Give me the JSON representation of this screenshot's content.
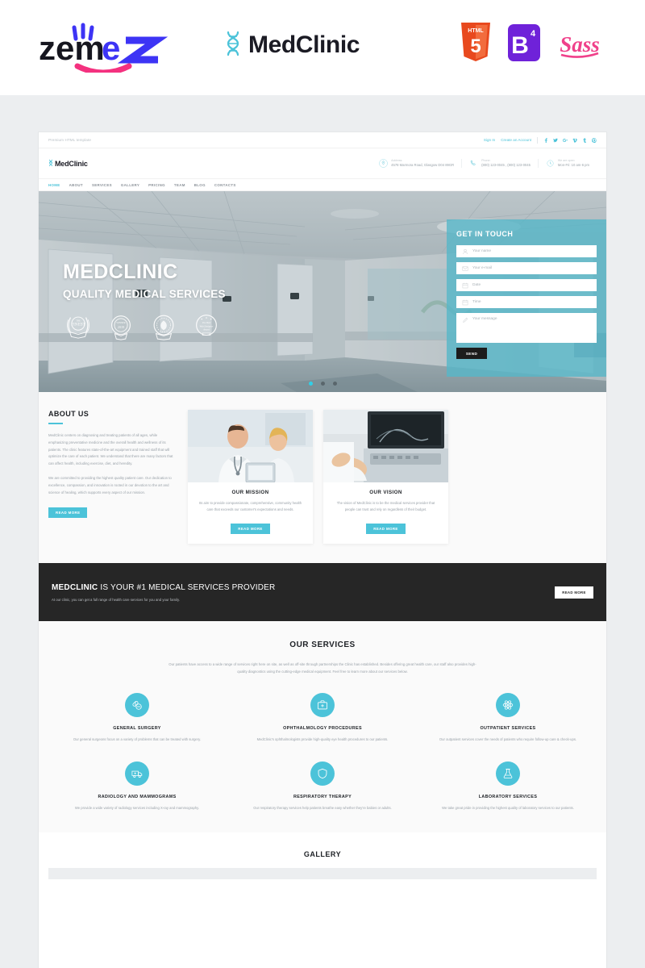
{
  "brandbar": {
    "zemez_logo_text": "zemez",
    "product_logo_text": "MedClinic",
    "badges": [
      {
        "name": "html5-badge",
        "label": "HTML",
        "sub": "5"
      },
      {
        "name": "bootstrap4-badge",
        "label": "B",
        "sub": "4"
      },
      {
        "name": "sass-badge",
        "label": "Sass"
      }
    ]
  },
  "site": {
    "topbar": {
      "tagline": "Premium HTML template",
      "sign_in": "Sign In",
      "create_account": "Create an Account",
      "social": [
        {
          "name": "facebook-icon"
        },
        {
          "name": "twitter-icon"
        },
        {
          "name": "google-plus-icon"
        },
        {
          "name": "vimeo-icon"
        },
        {
          "name": "tumblr-icon"
        },
        {
          "name": "pinterest-icon"
        }
      ]
    },
    "header": {
      "brand": "MedClinic",
      "contacts": [
        {
          "icon": "map-pin-icon",
          "label": "Address:",
          "value": "4578 Marmora Road, Glasgow D04 89GR"
        },
        {
          "icon": "phone-icon",
          "label": "Phone:",
          "value": "(800) 123-0045 , (800) 123-0045"
        },
        {
          "icon": "clock-icon",
          "label": "We are open:",
          "value": "Mon-Fri: 10 am-6 pm"
        }
      ]
    },
    "nav": [
      {
        "label": "HOME",
        "active": true
      },
      {
        "label": "ABOUT",
        "active": false
      },
      {
        "label": "SERVICES",
        "active": false
      },
      {
        "label": "GALLERY",
        "active": false
      },
      {
        "label": "PRICING",
        "active": false
      },
      {
        "label": "TEAM",
        "active": false
      },
      {
        "label": "BLOG",
        "active": false
      },
      {
        "label": "CONTACTS",
        "active": false
      }
    ],
    "hero": {
      "title": "MEDCLINIC",
      "subtitle": "QUALITY MEDICAL SERVICES",
      "awards": [
        {
          "name": "award-badge-finest"
        },
        {
          "name": "award-badge-winner"
        },
        {
          "name": "award-badge-quality"
        },
        {
          "name": "award-badge-best-design"
        }
      ],
      "form": {
        "title": "GET IN TOUCH",
        "fields": [
          {
            "icon": "user-icon",
            "placeholder": "Your name"
          },
          {
            "icon": "envelope-icon",
            "placeholder": "Your e-mail"
          },
          {
            "icon": "calendar-icon",
            "placeholder": "Date"
          },
          {
            "icon": "calendar-icon",
            "placeholder": "Time"
          }
        ],
        "message": {
          "icon": "pen-icon",
          "placeholder": "Your message"
        },
        "submit": "SEND"
      },
      "slider_dots": 3,
      "active_dot": 1
    },
    "about": {
      "title": "ABOUT US",
      "paragraph1": "MedClinic centers on diagnosing and treating patients of all ages, while emphasizing preventative medicine and the overall health and wellness of its patients. The clinic features state-of-the-art equipment and trained staff that will optimize the care of each patient. We understand that there are many factors that can affect health, including exercise, diet, and heredity.",
      "paragraph2": "We are committed to providing the highest quality patient care. Our dedication to excellence, compassion, and innovation is rooted in our devotion to the art and science of healing, which supports every aspect of our mission.",
      "read_more": "READ MORE",
      "cards": [
        {
          "image": "doctors-with-tablet-photo",
          "title": "OUR MISSION",
          "text": "Its aim to provide compassionate, comprehensive, community health care that exceeds our customer's expectations and needs.",
          "button": "READ MORE"
        },
        {
          "image": "ultrasound-equipment-photo",
          "title": "OUR VISION",
          "text": "The vision of MedClinic is to be the medical services provider that people can trust and rely on regardless of their budget.",
          "button": "READ MORE"
        }
      ]
    },
    "cta": {
      "heading_bold": "MEDCLINIC",
      "heading_rest": " IS YOUR #1 MEDICAL SERVICES PROVIDER",
      "subtext": "At our clinic, you can get a full range of health care services for you and your family.",
      "button": "READ MORE"
    },
    "services": {
      "title": "OUR SERVICES",
      "description": "Our patients have access to a wide range of services right here on site, as well as off-site through partnerships the Clinic has established. Besides offering great health care, our staff also provides high-quality diagnostics using the cutting-edge medical equipment. Feel free to learn more about our services below.",
      "items": [
        {
          "icon": "pills-icon",
          "name": "GENERAL SURGERY",
          "text": "Our general surgeons focus on a variety of problems that can be treated with surgery."
        },
        {
          "icon": "medical-bag-icon",
          "name": "OPHTHALMOLOGY PROCEDURES",
          "text": "MedClinic's ophthalmologists provide high-quality eye health procedures to our patients."
        },
        {
          "icon": "atom-icon",
          "name": "OUTPATIENT SERVICES",
          "text": "Our outpatient services cover the needs of patients who require follow-up care & check-ups."
        },
        {
          "icon": "ambulance-icon",
          "name": "RADIOLOGY AND MAMMOGRAMS",
          "text": "We provide a wide variety of radiology services including X-ray and mammography."
        },
        {
          "icon": "shield-icon",
          "name": "RESPIRATORY THERAPY",
          "text": "Our respiratory therapy services help patients breathe easy whether they're babies or adults."
        },
        {
          "icon": "flask-icon",
          "name": "LABORATORY SERVICES",
          "text": "We take great pride in providing the highest quality of laboratory services to our patients."
        }
      ]
    },
    "gallery": {
      "title": "GALLERY"
    }
  },
  "colors": {
    "accent": "#4cc3d9",
    "hero_form": "#56b7c8",
    "dark": "#262626",
    "zemez_blue": "#3d34f5",
    "zemez_pink": "#f4317f"
  }
}
